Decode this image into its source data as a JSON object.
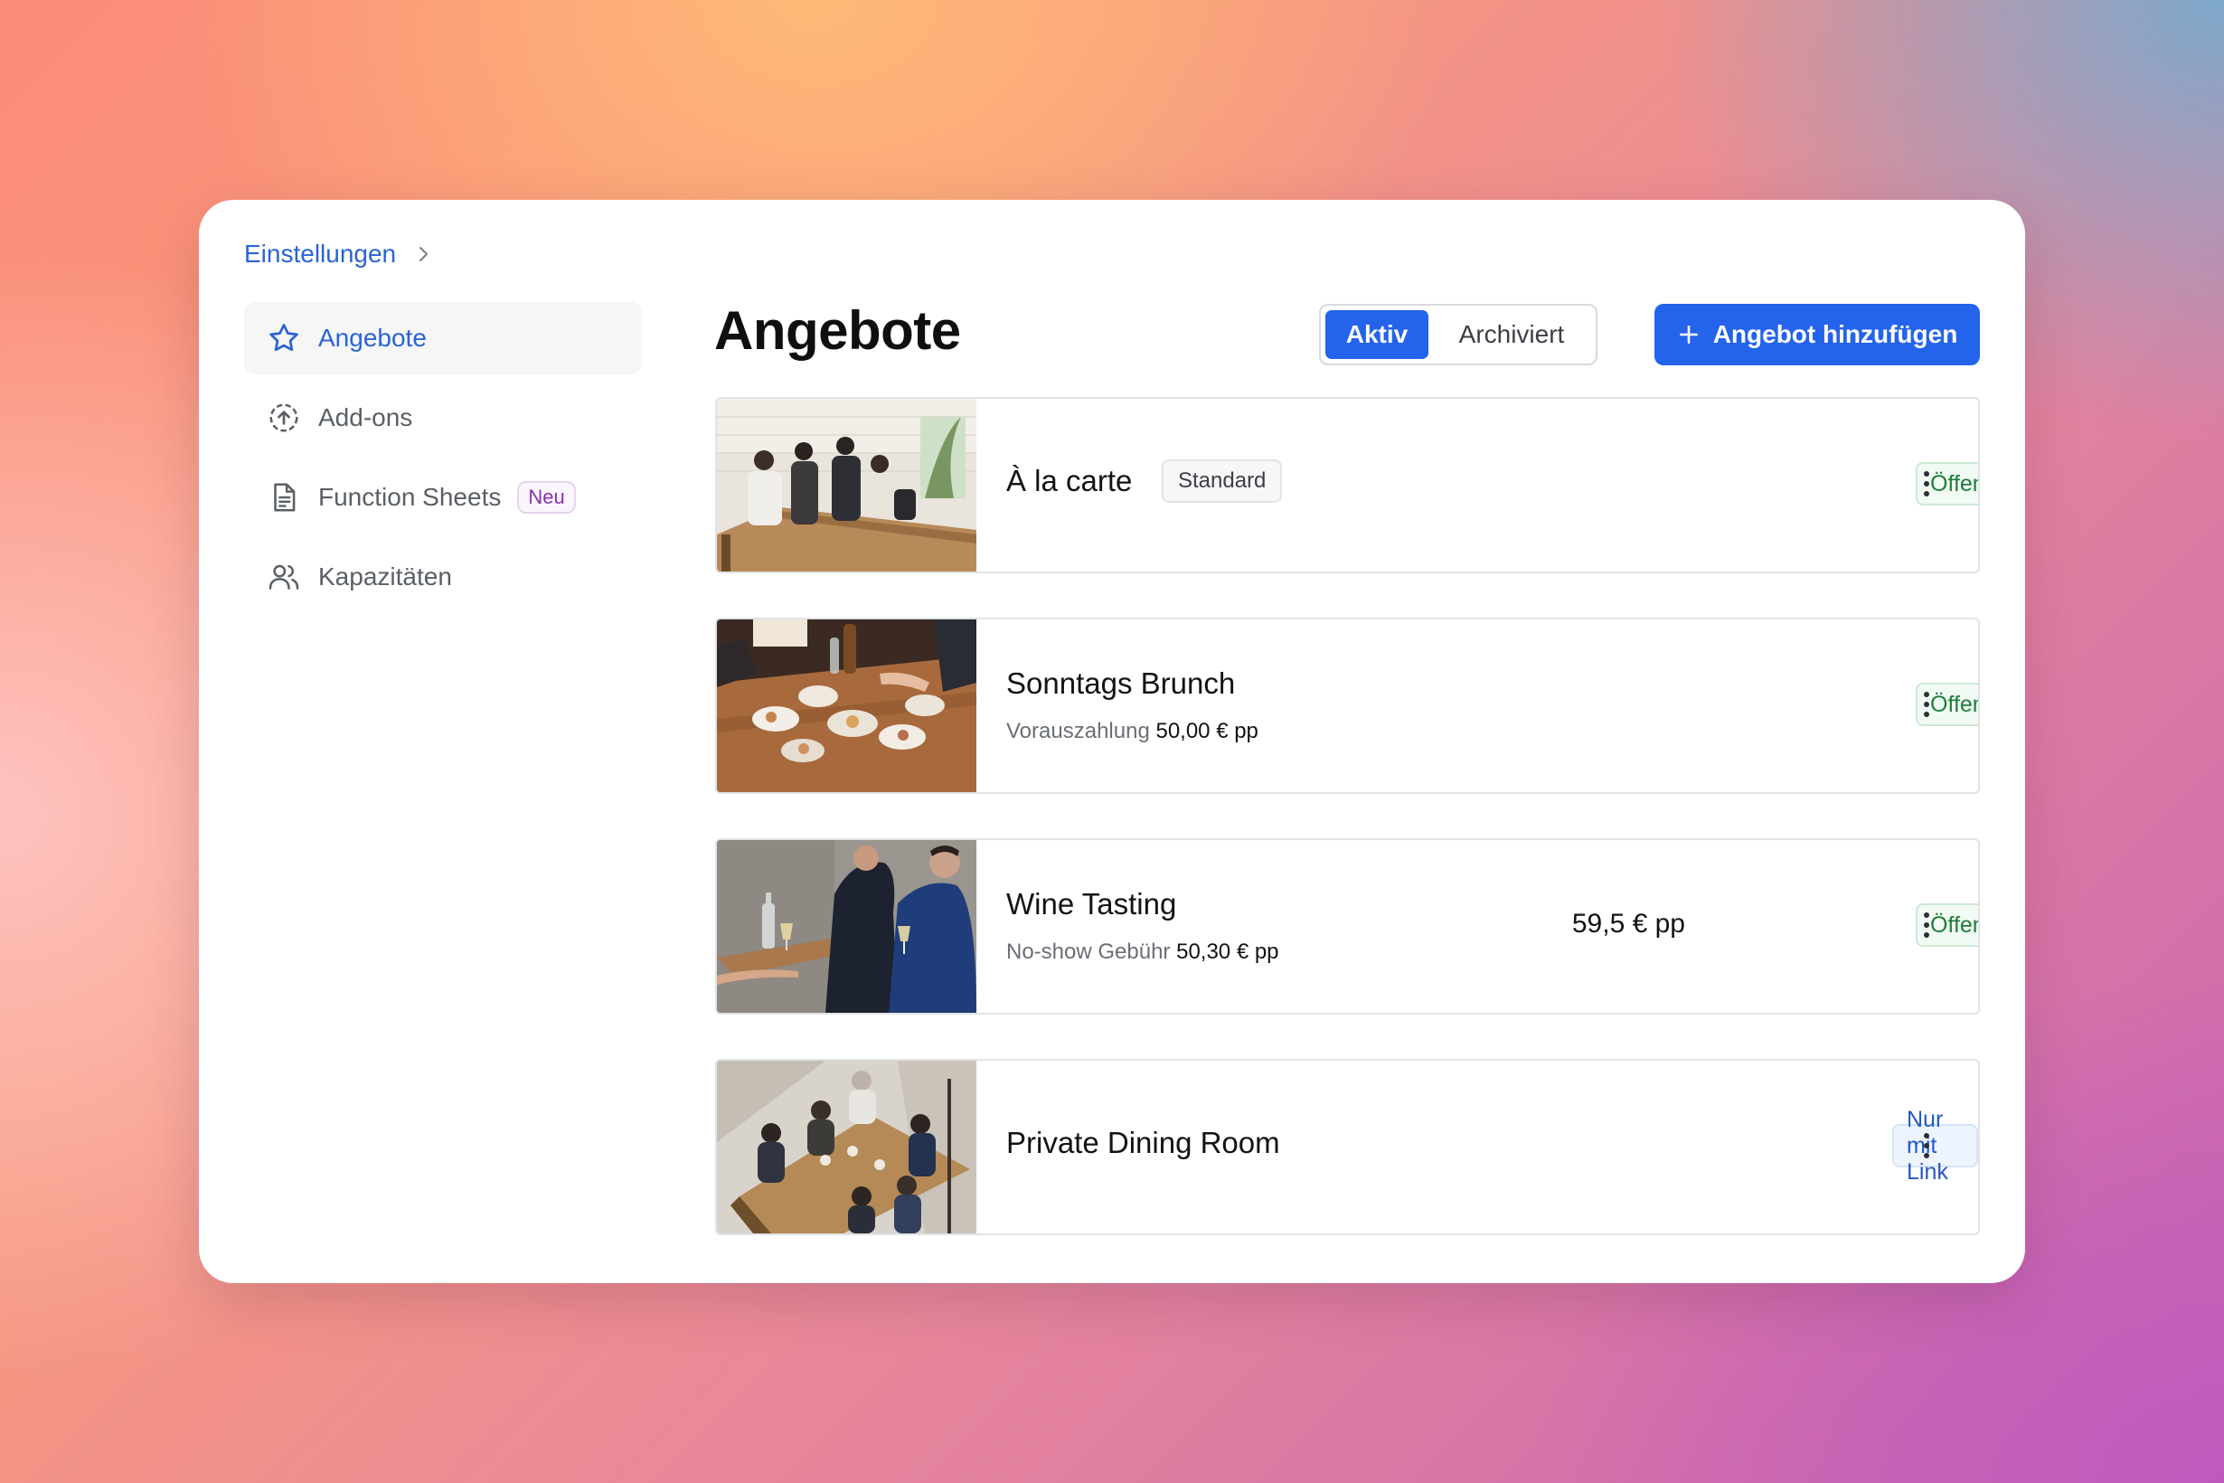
{
  "breadcrumb": {
    "parent": "Einstellungen"
  },
  "sidebar": {
    "items": [
      {
        "label": "Angebote",
        "icon": "star-icon",
        "active": true
      },
      {
        "label": "Add-ons",
        "icon": "upload-circle-icon",
        "active": false
      },
      {
        "label": "Function Sheets",
        "icon": "document-icon",
        "badge": "Neu",
        "active": false
      },
      {
        "label": "Kapazitäten",
        "icon": "users-icon",
        "active": false
      }
    ]
  },
  "main": {
    "title": "Angebote",
    "tabs": [
      {
        "label": "Aktiv",
        "selected": true
      },
      {
        "label": "Archiviert",
        "selected": false
      }
    ],
    "add_button": "Angebot hinzufügen"
  },
  "offers": [
    {
      "name": "À la carte",
      "tag": "Standard",
      "status": "Öffentlich",
      "subtitle_label": "",
      "subtitle_value": "",
      "price": ""
    },
    {
      "name": "Sonntags Brunch",
      "tag": "",
      "status": "Öffentlich",
      "subtitle_label": "Vorauszahlung",
      "subtitle_value": "50,00 € pp",
      "price": ""
    },
    {
      "name": "Wine Tasting",
      "tag": "",
      "status": "Öffentlich",
      "subtitle_label": "No-show Gebühr",
      "subtitle_value": "50,30 € pp",
      "price": "59,5 € pp"
    },
    {
      "name": "Private Dining Room",
      "tag": "",
      "status": "Nur mit Link",
      "subtitle_label": "",
      "subtitle_value": "",
      "price": ""
    }
  ],
  "colors": {
    "accent": "#2463eb",
    "link": "#2a63d4",
    "public_status": "#1d7f3a",
    "link_status": "#2358c4",
    "new_badge": "#8a2fb0"
  }
}
